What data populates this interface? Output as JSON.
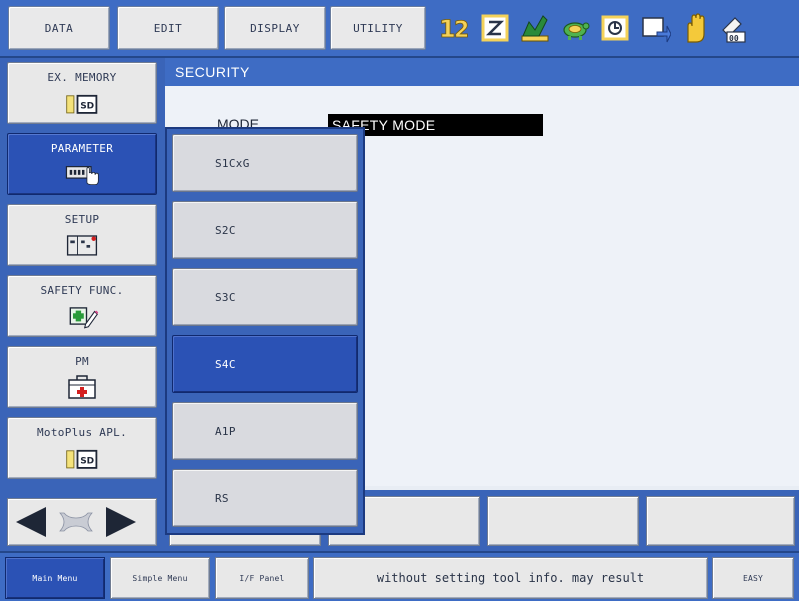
{
  "topbar": {
    "menus": [
      "DATA",
      "EDIT",
      "DISPLAY",
      "UTILITY"
    ],
    "status_icons": [
      "axis-1-2-icon",
      "coordinate-icon",
      "tool-icon",
      "speed-icon",
      "job-icon",
      "cycle-icon",
      "hand-icon",
      "servo-icon"
    ]
  },
  "main_menu": {
    "items": [
      {
        "label": "EX. MEMORY",
        "icon": "sd-card-icon"
      },
      {
        "label": "PARAMETER",
        "icon": "parameter-icon",
        "active": true
      },
      {
        "label": "SETUP",
        "icon": "setup-icon"
      },
      {
        "label": "SAFETY FUNC.",
        "icon": "safety-func-icon"
      },
      {
        "label": "PM",
        "icon": "first-aid-icon"
      },
      {
        "label": "MotoPlus APL.",
        "icon": "sd-card-icon"
      }
    ]
  },
  "content": {
    "title": "SECURITY",
    "mode_label": "MODE",
    "mode_value": "SAFETY MODE"
  },
  "submenu": {
    "items": [
      "S1CxG",
      "S2C",
      "S3C",
      "S4C",
      "A1P",
      "RS"
    ],
    "selected": "S4C"
  },
  "bottombar": {
    "main_menu": "Main Menu",
    "simple_menu": "Simple Menu",
    "if_panel": "I/F Panel",
    "message": "without setting tool info. may result",
    "easy": "EASY"
  },
  "colors": {
    "frame_blue": "#3e6cc4",
    "active_blue": "#2b52b5",
    "button_gray": "#e8e8e8"
  }
}
